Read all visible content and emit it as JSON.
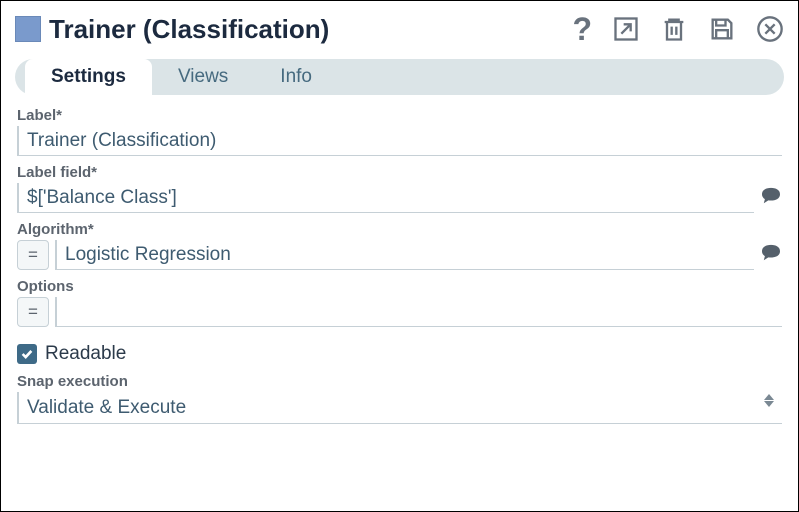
{
  "header": {
    "title": "Trainer (Classification)"
  },
  "tabs": {
    "settings": "Settings",
    "views": "Views",
    "info": "Info"
  },
  "form": {
    "label_field": {
      "label": "Label*",
      "value": "Trainer (Classification)"
    },
    "label_field2": {
      "label": "Label field*",
      "value": "$['Balance Class']"
    },
    "algorithm": {
      "label": "Algorithm*",
      "value": "Logistic Regression",
      "eq": "="
    },
    "options": {
      "label": "Options",
      "value": "",
      "eq": "="
    },
    "readable": {
      "label": "Readable",
      "checked": true
    },
    "snap_execution": {
      "label": "Snap execution",
      "value": "Validate & Execute"
    }
  }
}
